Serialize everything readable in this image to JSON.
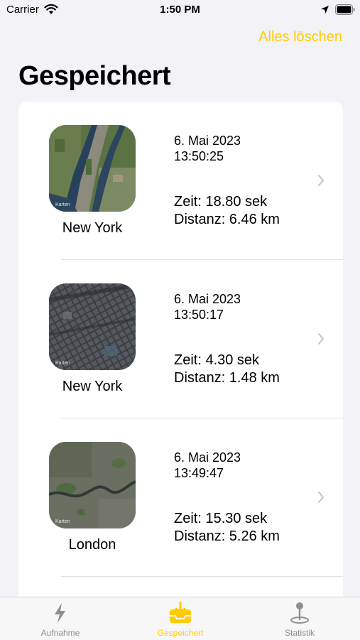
{
  "status_bar": {
    "carrier": "Carrier",
    "time": "1:50 PM"
  },
  "header": {
    "clear_all_label": "Alles löschen",
    "title": "Gespeichert"
  },
  "entries": [
    {
      "city": "New York",
      "date": "6. Mai 2023",
      "time": "13:50:25",
      "duration": "Zeit: 18.80 sek",
      "distance": "Distanz: 6.46 km",
      "map_label": "Karten"
    },
    {
      "city": "New York",
      "date": "6. Mai 2023",
      "time": "13:50:17",
      "duration": "Zeit: 4.30 sek",
      "distance": "Distanz: 1.48 km",
      "map_label": "Karten"
    },
    {
      "city": "London",
      "date": "6. Mai 2023",
      "time": "13:49:47",
      "duration": "Zeit: 15.30 sek",
      "distance": "Distanz: 5.26 km",
      "map_label": "Karten"
    }
  ],
  "tabs": [
    {
      "label": "Aufnahme",
      "icon": "lightning-icon",
      "active": false
    },
    {
      "label": "Gespeichert",
      "icon": "inbox-download-icon",
      "active": true
    },
    {
      "label": "Statistik",
      "icon": "map-pin-icon",
      "active": false
    }
  ],
  "colors": {
    "accent": "#ffcc00",
    "background": "#f2f2f7",
    "inactive_tab": "#8e8e93"
  }
}
